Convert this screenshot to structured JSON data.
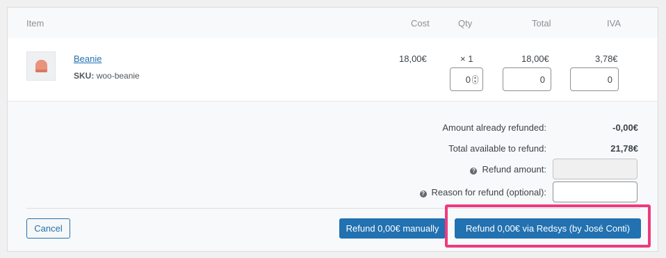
{
  "table": {
    "headers": {
      "item": "Item",
      "cost": "Cost",
      "qty": "Qty",
      "total": "Total",
      "tax": "IVA"
    }
  },
  "line_item": {
    "name": "Beanie",
    "sku_label": "SKU:",
    "sku_value": "woo-beanie",
    "cost": "18,00€",
    "qty": "× 1",
    "total": "18,00€",
    "tax": "3,78€",
    "refund_qty": "0",
    "refund_total": "0",
    "refund_tax": "0",
    "thumbnail_icon": "beanie-image"
  },
  "totals": {
    "already_refunded_label": "Amount already refunded:",
    "already_refunded_value": "-0,00€",
    "available_label": "Total available to refund:",
    "available_value": "21,78€",
    "refund_amount_label": "Refund amount:",
    "reason_label": "Reason for refund (optional):",
    "help_icon": "question-circle-icon"
  },
  "actions": {
    "cancel": "Cancel",
    "refund_manual": "Refund 0,00€ manually",
    "refund_gateway": "Refund 0,00€ via Redsys (by José Conti)"
  },
  "colors": {
    "primary": "#2271b1",
    "highlight": "#ef3a7e",
    "background": "#f8f9fa"
  }
}
